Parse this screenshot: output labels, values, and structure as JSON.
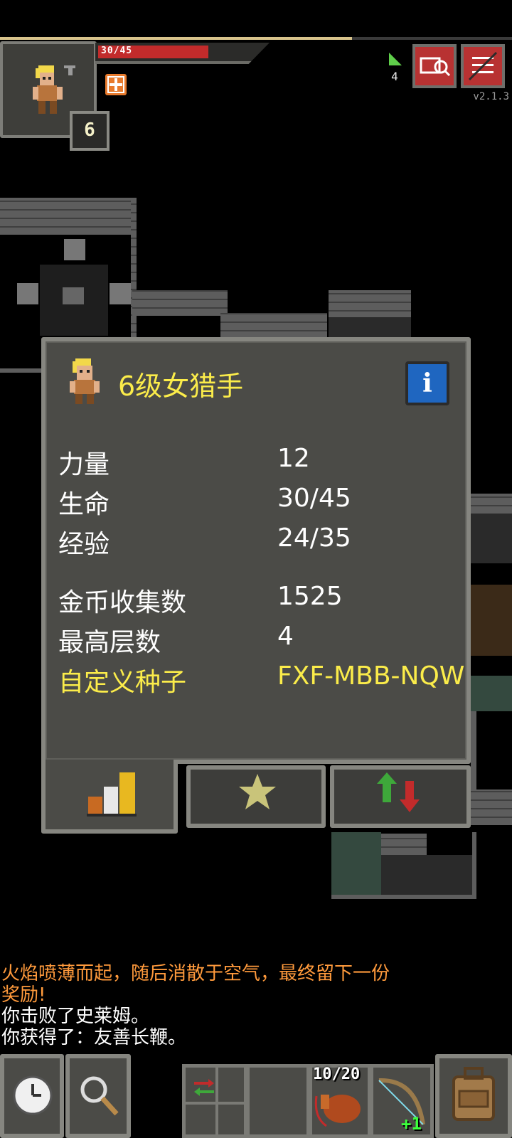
{
  "hud": {
    "hp_text": "30/45",
    "hp_fraction": 0.67,
    "xp_fraction": 0.686,
    "level": "6",
    "depth": "4",
    "version": "v2.1.3"
  },
  "hero_window": {
    "title": "6级女猎手",
    "info_label": "i",
    "stats": {
      "strength_label": "力量",
      "strength_value": "12",
      "hp_label": "生命",
      "hp_value": "30/45",
      "exp_label": "经验",
      "exp_value": "24/35",
      "gold_label": "金币收集数",
      "gold_value": "1525",
      "depth_label": "最高层数",
      "depth_value": "4",
      "seed_label": "自定义种子",
      "seed_value": "FXF-MBB-NQW"
    }
  },
  "tabs": [
    {
      "icon": "stats-bars-icon"
    },
    {
      "icon": "star-icon"
    },
    {
      "icon": "up-down-arrows-icon"
    }
  ],
  "log": {
    "line1": "火焰喷薄而起，随后消散于空气，最终留下一份",
    "line2": "奖励!",
    "line3": "你击败了史莱姆。",
    "line4": "你获得了：友善长鞭。"
  },
  "toolbar": {
    "wait_icon": "clock-icon",
    "search_icon": "magnifier-icon",
    "swap_icon": "swap-arrows-icon",
    "quickslot_item1_qty": "10/20",
    "quickslot_item2_bonus": "+1",
    "backpack_icon": "backpack-icon"
  },
  "colors": {
    "title_yellow": "#fbec4a",
    "hp_red": "#c22b2b",
    "log_orange": "#ff9a3c",
    "info_blue": "#1f66c0"
  }
}
